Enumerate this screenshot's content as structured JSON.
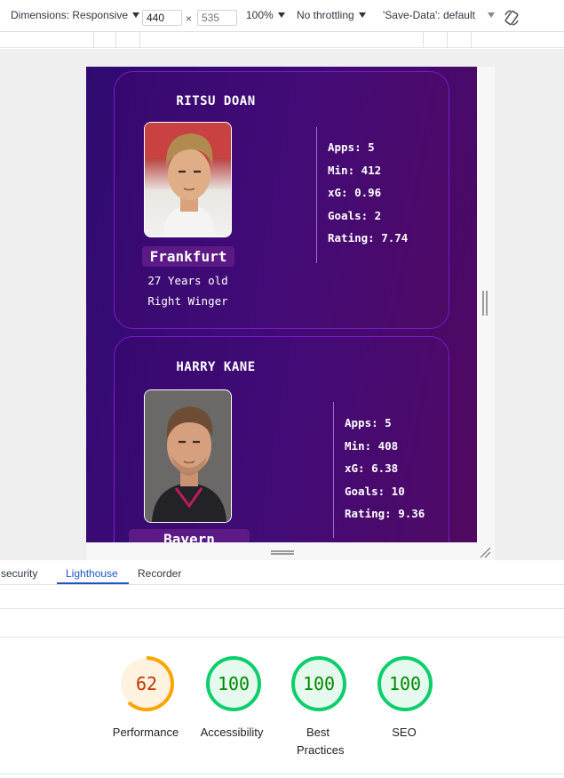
{
  "toolbar": {
    "dimensions_label": "Dimensions: Responsive",
    "width_value": "440",
    "height_placeholder": "535",
    "times": "×",
    "zoom": "100%",
    "throttling": "No throttling",
    "save_data": "'Save-Data': default"
  },
  "players": [
    {
      "name": "RITSU DOAN",
      "club": "Frankfurt",
      "age": "27 Years old",
      "position": "Right Winger",
      "stats": [
        "Apps: 5",
        "Min: 412",
        "xG: 0.96",
        "Goals: 2",
        "Rating: 7.74"
      ]
    },
    {
      "name": "HARRY KANE",
      "club": "Bayern Munich",
      "stats": [
        "Apps: 5",
        "Min: 408",
        "xG: 6.38",
        "Goals: 10",
        "Rating: 9.36"
      ]
    }
  ],
  "panel_tabs": [
    "security",
    "Lighthouse",
    "Recorder"
  ],
  "active_tab": "Lighthouse",
  "scores": [
    {
      "label": "Performance",
      "value": 62,
      "color": "#ffa400",
      "text_color": "#c33300",
      "bg": "#fff3e0"
    },
    {
      "label": "Accessibility",
      "value": 100,
      "color": "#0cce6b",
      "text_color": "#008800",
      "bg": "#e6f9ee"
    },
    {
      "label": "Best Practices",
      "value": 100,
      "color": "#0cce6b",
      "text_color": "#008800",
      "bg": "#e6f9ee"
    },
    {
      "label": "SEO",
      "value": 100,
      "color": "#0cce6b",
      "text_color": "#008800",
      "bg": "#e6f9ee"
    }
  ]
}
